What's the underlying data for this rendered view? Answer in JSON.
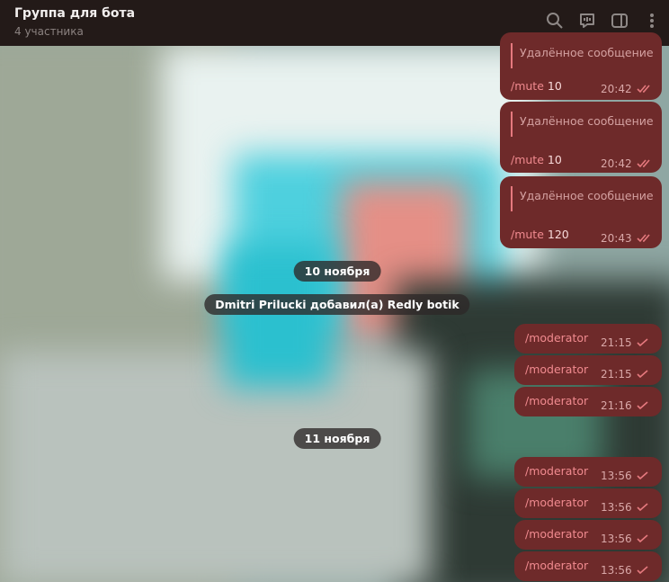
{
  "header": {
    "title": "Группа для бота",
    "subtitle": "4 участника"
  },
  "messages_replied": [
    {
      "reply": "Удалённое сообщение",
      "command": "/mute",
      "arg": "10",
      "time": "20:42"
    },
    {
      "reply": "Удалённое сообщение",
      "command": "/mute",
      "arg": "10",
      "time": "20:42"
    },
    {
      "reply": "Удалённое сообщение",
      "command": "/mute",
      "arg": "120",
      "time": "20:43"
    }
  ],
  "service": {
    "date1": "10 ноября",
    "added": "Dmitri Prilucki добавил(а) Redly botik",
    "date2": "11 ноября"
  },
  "messages_moderator_1": [
    {
      "text": "/moderator",
      "time": "21:15"
    },
    {
      "text": "/moderator",
      "time": "21:15"
    },
    {
      "text": "/moderator",
      "time": "21:16"
    }
  ],
  "messages_moderator_2": [
    {
      "text": "/moderator",
      "time": "13:56"
    },
    {
      "text": "/moderator",
      "time": "13:56"
    },
    {
      "text": "/moderator",
      "time": "13:56"
    },
    {
      "text": "/moderator",
      "time": "13:56"
    }
  ],
  "icons": [
    "search-icon",
    "video-chat-icon",
    "sidebar-toggle-icon",
    "more-icon"
  ],
  "colors": {
    "header_bg": "#231a18",
    "bubble_bg": "#6e2a2a",
    "accent": "#e5797e"
  }
}
